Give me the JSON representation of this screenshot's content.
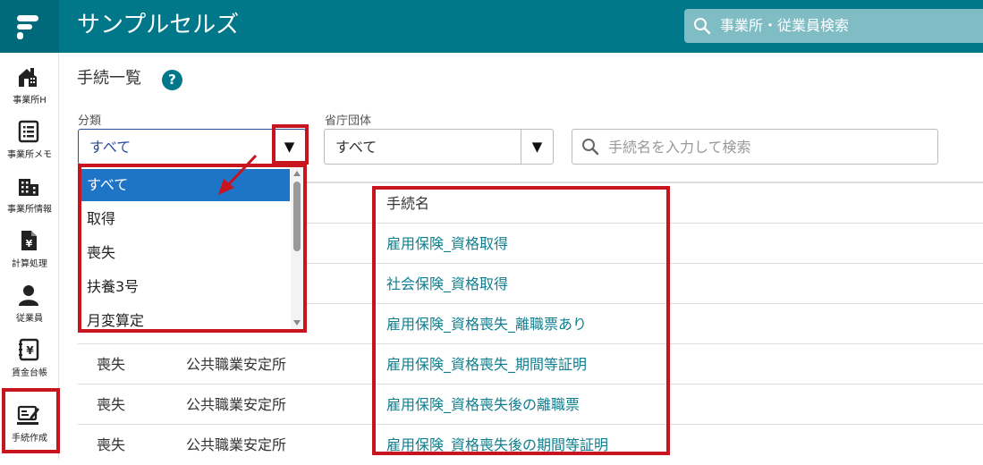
{
  "header": {
    "app_title": "サンプルセルズ",
    "search_placeholder": "事業所・従業員検索"
  },
  "sidebar": {
    "items": [
      {
        "label": "事業所H",
        "icon": "office-home-icon"
      },
      {
        "label": "事業所メモ",
        "icon": "memo-list-icon"
      },
      {
        "label": "事業所情報",
        "icon": "building-icon"
      },
      {
        "label": "計算処理",
        "icon": "yen-document-icon"
      },
      {
        "label": "従業員",
        "icon": "person-icon"
      },
      {
        "label": "賃金台帳",
        "icon": "yen-ledger-icon"
      },
      {
        "label": "手続作成",
        "icon": "procedure-create-icon"
      }
    ]
  },
  "main": {
    "title": "手続一覧",
    "help": "?",
    "category_label": "分類",
    "category_value": "すべて",
    "agency_label": "省庁団体",
    "agency_value": "すべて",
    "arrow_glyph": "▼",
    "search_placeholder": "手続名を入力して検索"
  },
  "dropdown": {
    "options": [
      "すべて",
      "取得",
      "喪失",
      "扶養3号",
      "月変算定"
    ],
    "selected": "すべて"
  },
  "table": {
    "header": "手続名",
    "rows": [
      {
        "category": "",
        "agency": "",
        "name": "雇用保険_資格取得"
      },
      {
        "category": "",
        "agency": "",
        "name": "社会保険_資格取得"
      },
      {
        "category": "",
        "agency": "",
        "name": "雇用保険_資格喪失_離職票あり"
      },
      {
        "category": "喪失",
        "agency": "公共職業安定所",
        "name": "雇用保険_資格喪失_期間等証明"
      },
      {
        "category": "喪失",
        "agency": "公共職業安定所",
        "name": "雇用保険_資格喪失後の離職票"
      },
      {
        "category": "喪失",
        "agency": "公共職業安定所",
        "name": "雇用保険_資格喪失後の期間等証明"
      }
    ]
  },
  "colors": {
    "header": "#00788a",
    "highlight": "#c8141e",
    "link": "#0f7f8f",
    "selected": "#1e74c6"
  }
}
